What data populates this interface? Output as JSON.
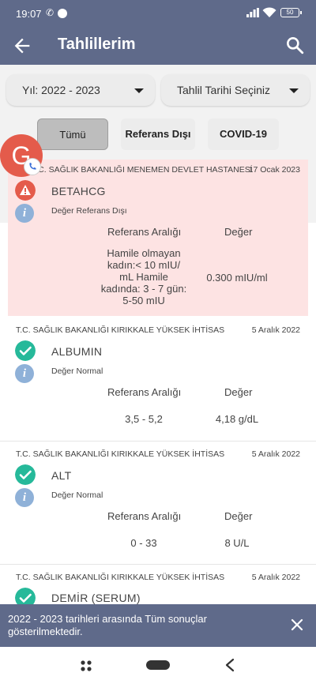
{
  "status_bar": {
    "time": "19:07",
    "battery": "50"
  },
  "app_bar": {
    "title": "Tahlillerim",
    "back_icon": "arrow-left-icon",
    "search_icon": "search-icon"
  },
  "filters": {
    "year_label": "Yıl: 2022 - 2023",
    "date_label": "Tahlil Tarihi Seçiniz",
    "chips": [
      "Tümü",
      "Referans Dışı",
      "COVID-19"
    ],
    "selected_chip": "Tümü"
  },
  "avatar": {
    "letter": "G"
  },
  "columns": {
    "ref": "Referans Aralığı",
    "val": "Değer"
  },
  "results": [
    {
      "hospital": "T.C. SAĞLIK BAKANLIĞI MENEMEN DEVLET HASTANESİ",
      "date": "17 Ocak 2023",
      "test": "BETAHCG",
      "status": "Değer Referans Dışı",
      "flagged": true,
      "ref_lines": [
        "Hamile olmayan",
        "kadın:< 10 mIU/",
        "mL Hamile",
        "kadında: 3 - 7 gün:",
        "5-50 mIU"
      ],
      "value": "0.300 mIU/ml"
    },
    {
      "hospital": "T.C. SAĞLIK BAKANLIĞI KIRIKKALE YÜKSEK İHTİSAS",
      "date": "5 Aralık 2022",
      "test": "ALBUMIN",
      "status": "Değer Normal",
      "flagged": false,
      "ref_lines": [
        "3,5 - 5,2"
      ],
      "value": "4,18 g/dL"
    },
    {
      "hospital": "T.C. SAĞLIK BAKANLIĞI KIRIKKALE YÜKSEK İHTİSAS",
      "date": "5 Aralık 2022",
      "test": "ALT",
      "status": "Değer Normal",
      "flagged": false,
      "ref_lines": [
        "0 - 33"
      ],
      "value": "8 U/L"
    },
    {
      "hospital": "T.C. SAĞLIK BAKANLIĞI KIRIKKALE YÜKSEK İHTİSAS",
      "date": "5 Aralık 2022",
      "test": "DEMİR (SERUM)",
      "flagged": false
    }
  ],
  "snackbar": {
    "message": "2022 - 2023 tarihleri arasında Tüm sonuçlar gösterilmektedir."
  },
  "colors": {
    "primary": "#5f6a8a",
    "warning": "#e45b4b",
    "success": "#26b99a",
    "info": "#8fb1d8",
    "flag_bg": "#fde3e3"
  }
}
